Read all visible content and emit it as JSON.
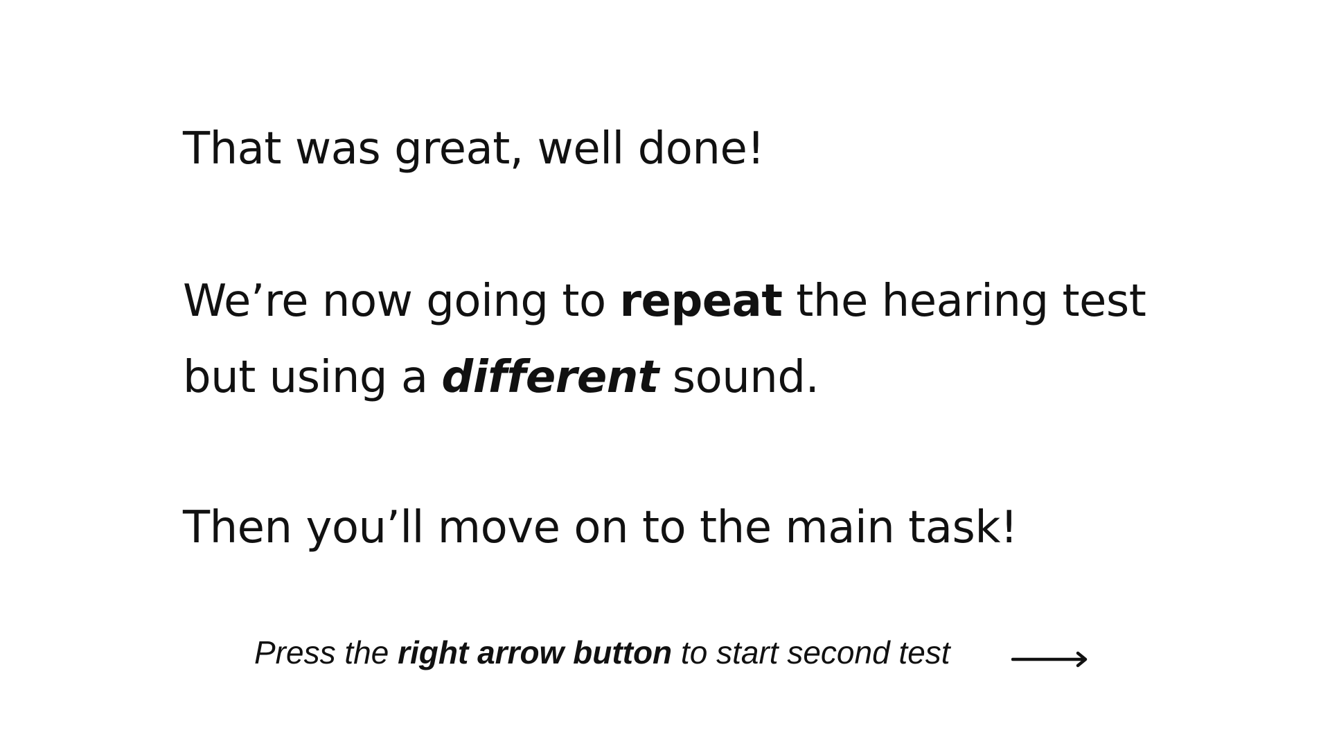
{
  "message": {
    "line_1": "That was great, well done!",
    "line_2": {
      "before": "We’re now going to ",
      "emphasis": "repeat",
      "after": " the hearing test"
    },
    "line_3": {
      "before": "but using a ",
      "emphasis": "different",
      "after": " sound."
    },
    "line_4": "Then you’ll move on to the main task!"
  },
  "hint": {
    "before": "Press the ",
    "emphasis": "right arrow button",
    "after": " to start second test"
  },
  "icons": {
    "arrow": "right-arrow-icon"
  },
  "colors": {
    "background": "#ffffff",
    "text": "#111111"
  }
}
